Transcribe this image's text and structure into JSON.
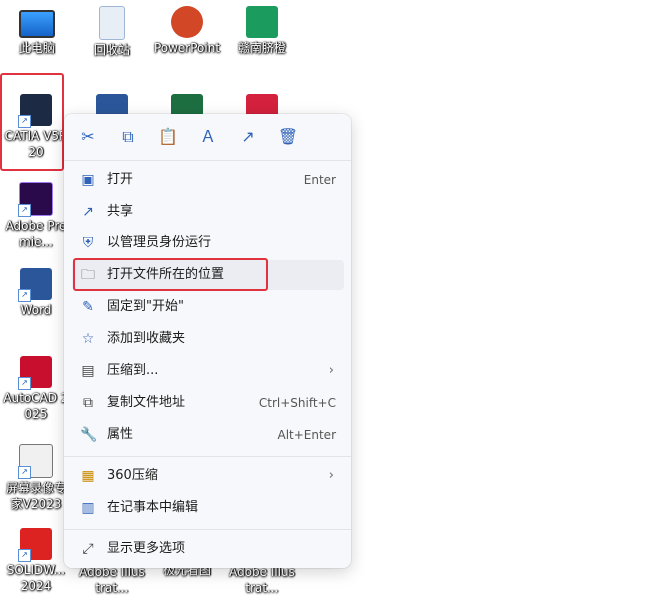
{
  "desktop": {
    "icons": [
      {
        "label": "此电脑",
        "icon": "monitor-icon"
      },
      {
        "label": "回收站",
        "icon": "recycle-bin-icon"
      },
      {
        "label": "PowerPoint",
        "icon": "powerpoint-icon"
      },
      {
        "label": "赣南脐橙",
        "icon": "sheet-app-icon"
      },
      {
        "label": "CATIA V5R20",
        "icon": "catia-icon"
      },
      {
        "label": "Adobe Premie...",
        "icon": "premiere-icon"
      },
      {
        "label": "Word",
        "icon": "word-icon"
      },
      {
        "label": "AutoCAD 2025",
        "icon": "autocad-icon"
      },
      {
        "label": "屏幕录像专家V2023",
        "icon": "screen-recorder-icon"
      },
      {
        "label": "SOLIDW... 2024",
        "icon": "solidworks-icon"
      },
      {
        "label": "Adobe Illustrat...",
        "icon": "illustrator-icon"
      },
      {
        "label": "极光看图",
        "icon": "image-viewer-icon"
      },
      {
        "label": "Adobe Illustrat...",
        "icon": "illustrator-icon"
      }
    ]
  },
  "context_menu": {
    "toolbar": [
      {
        "name": "cut",
        "glyph": "✂"
      },
      {
        "name": "copy",
        "glyph": "⧉"
      },
      {
        "name": "paste",
        "glyph": "📋"
      },
      {
        "name": "rename",
        "glyph": "Ａ"
      },
      {
        "name": "share",
        "glyph": "↗"
      },
      {
        "name": "delete",
        "glyph": "🗑"
      }
    ],
    "items": [
      {
        "label": "打开",
        "shortcut": "Enter",
        "icon": "open-icon"
      },
      {
        "label": "共享",
        "shortcut": "",
        "icon": "share-icon"
      },
      {
        "label": "以管理员身份运行",
        "shortcut": "",
        "icon": "shield-icon"
      },
      {
        "label": "打开文件所在的位置",
        "shortcut": "",
        "icon": "folder-icon"
      },
      {
        "label": "固定到\"开始\"",
        "shortcut": "",
        "icon": "pin-icon"
      },
      {
        "label": "添加到收藏夹",
        "shortcut": "",
        "icon": "star-icon"
      },
      {
        "label": "压缩到...",
        "shortcut": "",
        "icon": "zip-icon",
        "submenu": "›"
      },
      {
        "label": "复制文件地址",
        "shortcut": "Ctrl+Shift+C",
        "icon": "copy-path-icon"
      },
      {
        "label": "属性",
        "shortcut": "Alt+Enter",
        "icon": "wrench-icon"
      },
      {
        "label": "360压缩",
        "shortcut": "",
        "icon": "360-zip-icon",
        "submenu": "›"
      },
      {
        "label": "在记事本中编辑",
        "shortcut": "",
        "icon": "notepad-icon"
      },
      {
        "label": "显示更多选项",
        "shortcut": "",
        "icon": "more-options-icon"
      }
    ]
  }
}
